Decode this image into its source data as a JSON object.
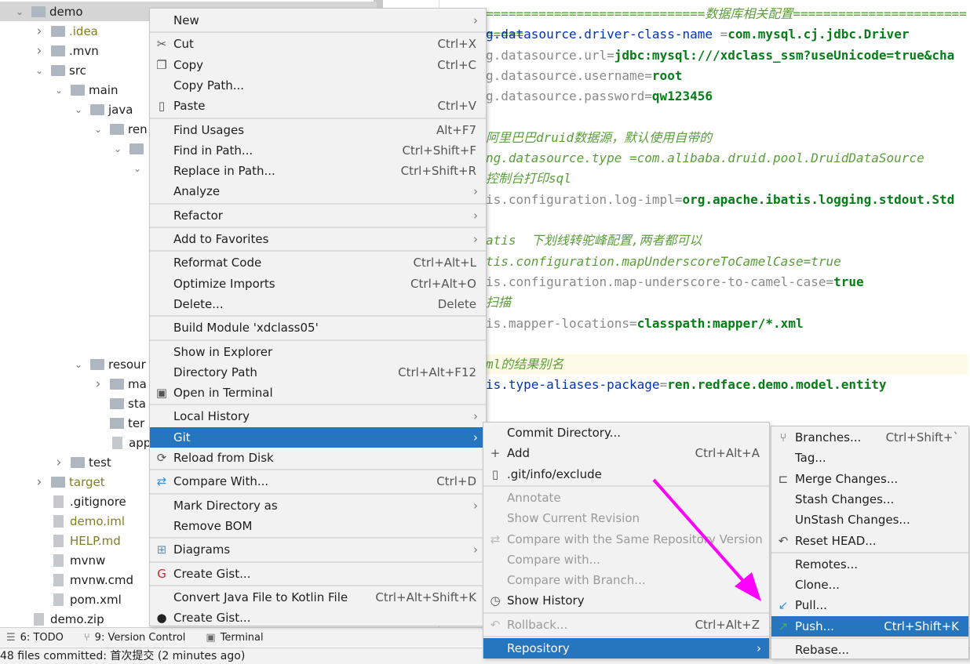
{
  "tree": [
    {
      "label": "demo",
      "depth": 0,
      "chev": "open",
      "kind": "folder",
      "sel": true
    },
    {
      "label": ".idea",
      "depth": 1,
      "chev": "closed",
      "kind": "folder",
      "olive": true
    },
    {
      "label": ".mvn",
      "depth": 1,
      "chev": "closed",
      "kind": "folder"
    },
    {
      "label": "src",
      "depth": 1,
      "chev": "open",
      "kind": "folder"
    },
    {
      "label": "main",
      "depth": 2,
      "chev": "open",
      "kind": "folder"
    },
    {
      "label": "java",
      "depth": 3,
      "chev": "open",
      "kind": "folder"
    },
    {
      "label": "ren",
      "depth": 4,
      "chev": "open",
      "kind": "folder"
    },
    {
      "label": "",
      "depth": 5,
      "chev": "open",
      "kind": "folder"
    },
    {
      "label": "",
      "depth": 6,
      "chev": "open",
      "kind": "none"
    },
    null,
    null,
    null,
    null,
    null,
    null,
    null,
    null,
    null,
    {
      "label": "resour",
      "depth": 3,
      "chev": "open",
      "kind": "folder"
    },
    {
      "label": "ma",
      "depth": 4,
      "chev": "closed",
      "kind": "folder"
    },
    {
      "label": "sta",
      "depth": 4,
      "chev": "none",
      "kind": "folder"
    },
    {
      "label": "ter",
      "depth": 4,
      "chev": "none",
      "kind": "folder"
    },
    {
      "label": "app",
      "depth": 4,
      "chev": "none",
      "kind": "file"
    },
    {
      "label": "test",
      "depth": 2,
      "chev": "closed",
      "kind": "folder"
    },
    {
      "label": "target",
      "depth": 1,
      "chev": "closed",
      "kind": "folder",
      "olive": true
    },
    {
      "label": ".gitignore",
      "depth": 1,
      "chev": "none",
      "kind": "file"
    },
    {
      "label": "demo.iml",
      "depth": 1,
      "chev": "none",
      "kind": "file",
      "olive": true
    },
    {
      "label": "HELP.md",
      "depth": 1,
      "chev": "none",
      "kind": "file",
      "olive": true
    },
    {
      "label": "mvnw",
      "depth": 1,
      "chev": "none",
      "kind": "file"
    },
    {
      "label": "mvnw.cmd",
      "depth": 1,
      "chev": "none",
      "kind": "file"
    },
    {
      "label": "pom.xml",
      "depth": 1,
      "chev": "none",
      "kind": "file"
    },
    {
      "label": "demo.zip",
      "depth": 0,
      "chev": "none",
      "kind": "file"
    }
  ],
  "code": [
    {
      "row": 0,
      "seg": [
        [
          "c",
          "=============================数据库相关配置============================"
        ]
      ]
    },
    {
      "row": 1,
      "seg": [
        [
          "k",
          "g.datasource.driver-class-name "
        ],
        [
          "g",
          "="
        ],
        [
          "v",
          "com.mysql.cj.jdbc.Driver"
        ]
      ]
    },
    {
      "row": 2,
      "seg": [
        [
          "g",
          "g.datasource.url="
        ],
        [
          "v",
          "jdbc:mysql:///xdclass_ssm?useUnicode=true&cha"
        ]
      ]
    },
    {
      "row": 3,
      "seg": [
        [
          "g",
          "g.datasource.username="
        ],
        [
          "v",
          "root"
        ]
      ]
    },
    {
      "row": 4,
      "seg": [
        [
          "g",
          "g.datasource.password="
        ],
        [
          "v",
          "qw123456"
        ]
      ]
    },
    {
      "row": 6,
      "seg": [
        [
          "c",
          "阿里巴巴druid数据源，默认使用自带的"
        ]
      ]
    },
    {
      "row": 7,
      "seg": [
        [
          "c",
          "ng.datasource.type =com.alibaba.druid.pool.DruidDataSource"
        ]
      ]
    },
    {
      "row": 8,
      "seg": [
        [
          "c",
          "控制台打印sql"
        ]
      ]
    },
    {
      "row": 9,
      "seg": [
        [
          "g",
          "is.configuration.log-impl="
        ],
        [
          "v",
          "org.apache.ibatis.logging.stdout.Std"
        ]
      ]
    },
    {
      "row": 11,
      "seg": [
        [
          "c",
          "atis  下划线转驼峰配置,两者都可以"
        ]
      ]
    },
    {
      "row": 12,
      "seg": [
        [
          "c",
          "tis.configuration.mapUnderscoreToCamelCase=true"
        ]
      ]
    },
    {
      "row": 13,
      "seg": [
        [
          "g",
          "is.configuration.map-underscore-to-camel-case="
        ],
        [
          "v",
          "true"
        ]
      ]
    },
    {
      "row": 14,
      "seg": [
        [
          "c",
          "扫描"
        ]
      ]
    },
    {
      "row": 15,
      "seg": [
        [
          "g",
          "is.mapper-locations="
        ],
        [
          "v",
          "classpath:mapper/*.xml"
        ]
      ]
    },
    {
      "row": 17,
      "seg": [
        [
          "c",
          "ml的结果别名"
        ]
      ],
      "hl": true
    },
    {
      "row": 18,
      "seg": [
        [
          "k",
          "is.type-aliases-package"
        ],
        [
          "g",
          "="
        ],
        [
          "v",
          "ren.redface.demo.model.entity"
        ]
      ]
    }
  ],
  "context_menu": [
    {
      "label": "New",
      "arrow": true
    },
    "sep",
    {
      "label": "Cut",
      "icon": "cut-icon",
      "glyph": "✂",
      "shortcut": "Ctrl+X"
    },
    {
      "label": "Copy",
      "icon": "copy-icon",
      "glyph": "❐",
      "shortcut": "Ctrl+C"
    },
    {
      "label": "Copy Path..."
    },
    {
      "label": "Paste",
      "icon": "paste-icon",
      "glyph": "▯",
      "shortcut": "Ctrl+V"
    },
    "sep",
    {
      "label": "Find Usages",
      "shortcut": "Alt+F7"
    },
    {
      "label": "Find in Path...",
      "shortcut": "Ctrl+Shift+F"
    },
    {
      "label": "Replace in Path...",
      "shortcut": "Ctrl+Shift+R"
    },
    {
      "label": "Analyze",
      "arrow": true
    },
    "sep",
    {
      "label": "Refactor",
      "arrow": true
    },
    "sep",
    {
      "label": "Add to Favorites",
      "arrow": true
    },
    "sep",
    {
      "label": "Reformat Code",
      "shortcut": "Ctrl+Alt+L"
    },
    {
      "label": "Optimize Imports",
      "shortcut": "Ctrl+Alt+O"
    },
    {
      "label": "Delete...",
      "shortcut": "Delete"
    },
    "sep",
    {
      "label": "Build Module 'xdclass05'"
    },
    "sep",
    {
      "label": "Show in Explorer"
    },
    {
      "label": "Directory Path",
      "shortcut": "Ctrl+Alt+F12"
    },
    {
      "label": "Open in Terminal",
      "icon": "terminal-icon",
      "glyph": "▣"
    },
    "sep",
    {
      "label": "Local History",
      "arrow": true
    },
    {
      "label": "Git",
      "arrow": true,
      "hi": true
    },
    {
      "label": "Reload from Disk",
      "icon": "reload-icon",
      "glyph": "⟳"
    },
    "sep",
    {
      "label": "Compare With...",
      "icon": "compare-icon",
      "glyph": "⇄",
      "color": "#3d8fd6",
      "shortcut": "Ctrl+D"
    },
    "sep",
    {
      "label": "Mark Directory as",
      "arrow": true
    },
    {
      "label": "Remove BOM"
    },
    "sep",
    {
      "label": "Diagrams",
      "icon": "diagrams-icon",
      "glyph": "⊞",
      "color": "#6a8fb0",
      "arrow": true
    },
    "sep",
    {
      "label": "Create Gist...",
      "icon": "gitee-gist-icon",
      "glyph": "G",
      "color": "#d9242a"
    },
    "sep",
    {
      "label": "Convert Java File to Kotlin File",
      "shortcut": "Ctrl+Alt+Shift+K"
    },
    {
      "label": "Create Gist...",
      "icon": "github-icon",
      "glyph": "●",
      "color": "#222"
    }
  ],
  "git_menu": [
    {
      "label": "Commit Directory..."
    },
    {
      "label": "Add",
      "icon": "plus-icon",
      "glyph": "+",
      "shortcut": "Ctrl+Alt+A"
    },
    {
      "label": ".git/info/exclude",
      "icon": "gitignore-file-icon",
      "glyph": "▯"
    },
    "sep",
    {
      "label": "Annotate",
      "dis": true
    },
    {
      "label": "Show Current Revision",
      "dis": true
    },
    {
      "label": "Compare with the Same Repository Version",
      "icon": "compare-icon",
      "glyph": "⇄",
      "dis": true
    },
    {
      "label": "Compare with...",
      "dis": true
    },
    {
      "label": "Compare with Branch...",
      "dis": true
    },
    {
      "label": "Show History",
      "icon": "clock-icon",
      "glyph": "◷"
    },
    "sep",
    {
      "label": "Rollback...",
      "icon": "rollback-icon",
      "glyph": "↶",
      "shortcut": "Ctrl+Alt+Z",
      "dis": true
    },
    "sep",
    {
      "label": "Repository",
      "arrow": true,
      "hi": true
    }
  ],
  "repo_menu": [
    {
      "label": "Branches...",
      "icon": "branches-icon",
      "glyph": "⑂",
      "shortcut": "Ctrl+Shift+`"
    },
    {
      "label": "Tag..."
    },
    {
      "label": "Merge Changes...",
      "icon": "merge-icon",
      "glyph": "⊏"
    },
    {
      "label": "Stash Changes..."
    },
    {
      "label": "UnStash Changes..."
    },
    {
      "label": "Reset HEAD...",
      "icon": "reset-icon",
      "glyph": "↶"
    },
    "sep",
    {
      "label": "Remotes..."
    },
    {
      "label": "Clone..."
    },
    {
      "label": "Pull...",
      "icon": "pull-icon",
      "glyph": "↙",
      "color": "#3d8fd6"
    },
    {
      "label": "Push...",
      "icon": "push-icon",
      "glyph": "↗",
      "color": "#4caf50",
      "shortcut": "Ctrl+Shift+K",
      "hi": true
    },
    "sep",
    {
      "label": "Rebase..."
    }
  ],
  "toolbar": {
    "todo": "6: TODO",
    "vcs": "9: Version Control",
    "terminal": "Terminal"
  },
  "status": "48 files committed: 首次提交 (2 minutes ago)",
  "colors": {
    "highlight": "#2675bf",
    "annotation_arrow": "#ff00ff"
  }
}
